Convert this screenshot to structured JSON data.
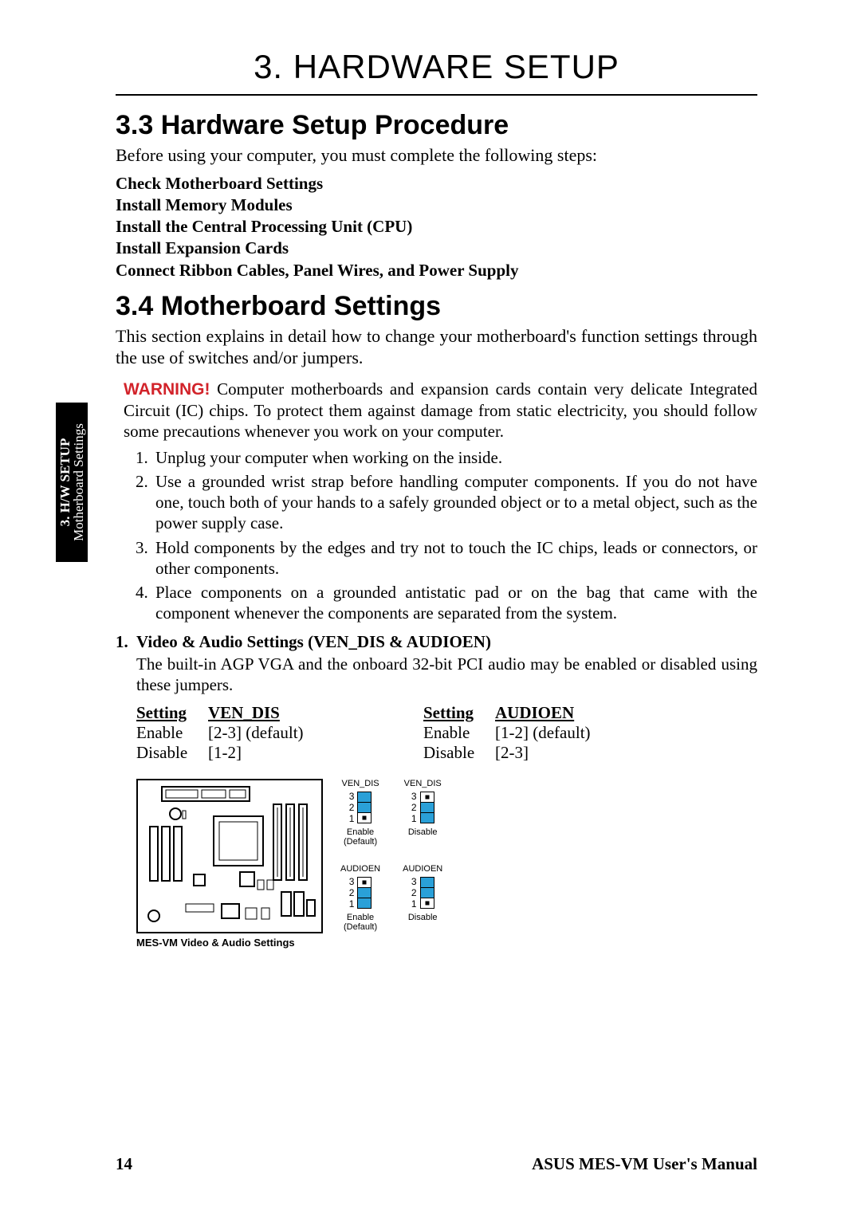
{
  "chapter_title": "3. HARDWARE SETUP",
  "side_tab": {
    "line1": "3. H/W SETUP",
    "line2": "Motherboard Settings"
  },
  "s33": {
    "heading": "3.3  Hardware Setup Procedure",
    "intro": "Before using your computer, you must complete the following steps:",
    "steps": [
      "Check Motherboard Settings",
      "Install Memory Modules",
      "Install the Central Processing Unit (CPU)",
      "Install Expansion Cards",
      "Connect Ribbon Cables, Panel Wires, and Power Supply"
    ]
  },
  "s34": {
    "heading": "3.4  Motherboard Settings",
    "intro": "This section explains in detail how to change your motherboard's function settings through the use of switches and/or jumpers.",
    "warning_label": "WARNING!",
    "warning_text": " Computer motherboards and expansion cards contain very delicate Integrated Circuit (IC) chips. To protect them against damage from static electricity, you should follow some precautions whenever you work on your computer.",
    "precautions": [
      "Unplug your computer when working on the inside.",
      "Use a grounded wrist strap before handling computer components. If you do not have one, touch both of your hands to a safely grounded object or to a metal object, such as the power supply case.",
      "Hold components by the edges and try not to touch the IC chips, leads or connectors, or other components.",
      "Place components on a grounded antistatic pad or on the bag that came with the component whenever the components are separated from the system."
    ],
    "sub1": {
      "num": "1.",
      "title": "Video & Audio Settings (VEN_DIS & AUDIOEN)",
      "body": "The built-in AGP VGA and the onboard 32-bit PCI audio may be enabled or disabled using these jumpers."
    },
    "tables": {
      "left": {
        "h1": "Setting",
        "h2": "VEN_DIS",
        "r1c1": "Enable",
        "r1c2": "[2-3]  (default)",
        "r2c1": "Disable",
        "r2c2": "[1-2]"
      },
      "right": {
        "h1": "Setting",
        "h2": "AUDIOEN",
        "r1c1": "Enable",
        "r1c2": "[1-2]  (default)",
        "r2c1": "Disable",
        "r2c2": "[2-3]"
      }
    },
    "diagram_caption": "MES-VM Video & Audio Settings",
    "jumper_diagrams": {
      "pin_labels": {
        "p3": "3",
        "p2": "2",
        "p1": "1"
      },
      "a": {
        "top": "VEN_DIS",
        "bot1": "Enable",
        "bot2": "(Default)"
      },
      "b": {
        "top": "VEN_DIS",
        "bot1": "Disable",
        "bot2": ""
      },
      "c": {
        "top": "AUDIOEN",
        "bot1": "Enable",
        "bot2": "(Default)"
      },
      "d": {
        "top": "AUDIOEN",
        "bot1": "Disable",
        "bot2": ""
      }
    }
  },
  "footer": {
    "page": "14",
    "title": "ASUS MES-VM User's Manual"
  }
}
